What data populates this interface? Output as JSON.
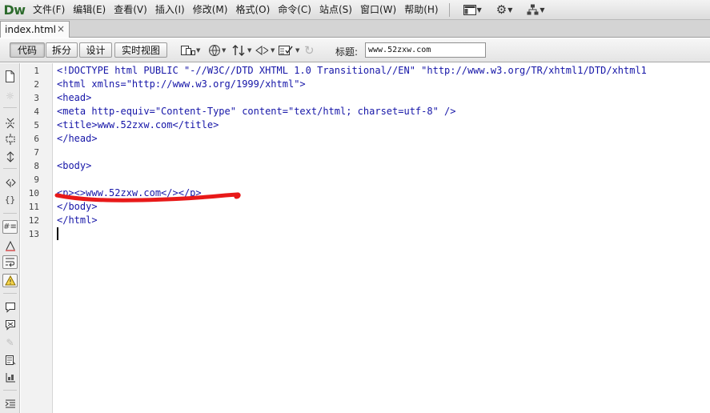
{
  "app": {
    "logo": "Dw"
  },
  "menubar": {
    "items": [
      {
        "id": "file",
        "label": "文件(F)"
      },
      {
        "id": "edit",
        "label": "编辑(E)"
      },
      {
        "id": "view",
        "label": "查看(V)"
      },
      {
        "id": "insert",
        "label": "插入(I)"
      },
      {
        "id": "modify",
        "label": "修改(M)"
      },
      {
        "id": "format",
        "label": "格式(O)"
      },
      {
        "id": "commands",
        "label": "命令(C)"
      },
      {
        "id": "site",
        "label": "站点(S)"
      },
      {
        "id": "window",
        "label": "窗口(W)"
      },
      {
        "id": "help",
        "label": "帮助(H)"
      }
    ],
    "right_icons": [
      "layout-icon",
      "gear-icon",
      "site-map-icon"
    ]
  },
  "tabs": {
    "active_file": "index.html",
    "close_glyph": "×"
  },
  "doc_toolbar": {
    "view_buttons": [
      {
        "id": "code",
        "label": "代码",
        "active": true
      },
      {
        "id": "split",
        "label": "拆分",
        "active": false
      },
      {
        "id": "design",
        "label": "设计",
        "active": false
      },
      {
        "id": "live",
        "label": "实时视图",
        "active": false
      }
    ],
    "title_label": "标题:",
    "title_value": "www.52zxw.com",
    "icons": [
      "multiscreen-icon",
      "preview-globe-icon",
      "file-transfer-icon",
      "visual-aids-icon",
      "validate-icon",
      "refresh-icon"
    ]
  },
  "editor": {
    "line_numbers": [
      "1",
      "2",
      "3",
      "4",
      "5",
      "6",
      "7",
      "8",
      "9",
      "10",
      "11",
      "12",
      "13"
    ],
    "lines": [
      "<!DOCTYPE html PUBLIC \"-//W3C//DTD XHTML 1.0 Transitional//EN\" \"http://www.w3.org/TR/xhtml1/DTD/xhtml1",
      "<html xmlns=\"http://www.w3.org/1999/xhtml\">",
      "<head>",
      "<meta http-equiv=\"Content-Type\" content=\"text/html; charset=utf-8\" />",
      "<title>www.52zxw.com</title>",
      "</head>",
      "",
      "<body>",
      "",
      "<p><>www.52zxw.com</></p>",
      "</body>",
      "</html>",
      ""
    ],
    "annotation_color": "#e81919"
  }
}
